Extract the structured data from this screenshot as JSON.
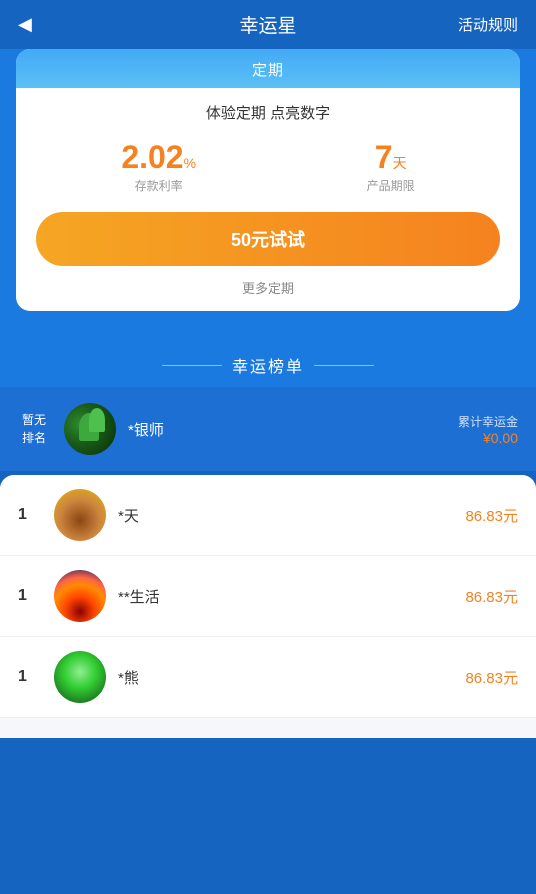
{
  "header": {
    "back_icon": "◀",
    "title": "幸运星",
    "rule_link": "活动规则"
  },
  "product_card": {
    "header_label": "定期",
    "subtitle": "体验定期 点亮数字",
    "rate_value": "2.02",
    "rate_unit": "%",
    "rate_label": "存款利率",
    "days_value": "7",
    "days_unit": "天",
    "days_label": "产品期限",
    "btn_label": "50元试试",
    "more_label": "更多定期"
  },
  "leaderboard": {
    "title": "幸运榜单",
    "my_rank": {
      "rank_line1": "暂无",
      "rank_line2": "排名",
      "name": "*银师",
      "amount_label": "累计幸运金",
      "amount": "¥0.00"
    },
    "list": [
      {
        "rank": "1",
        "name": "*天",
        "amount": "86.83元"
      },
      {
        "rank": "1",
        "name": "**生活",
        "amount": "86.83元"
      },
      {
        "rank": "1",
        "name": "*熊",
        "amount": "86.83元"
      }
    ]
  }
}
